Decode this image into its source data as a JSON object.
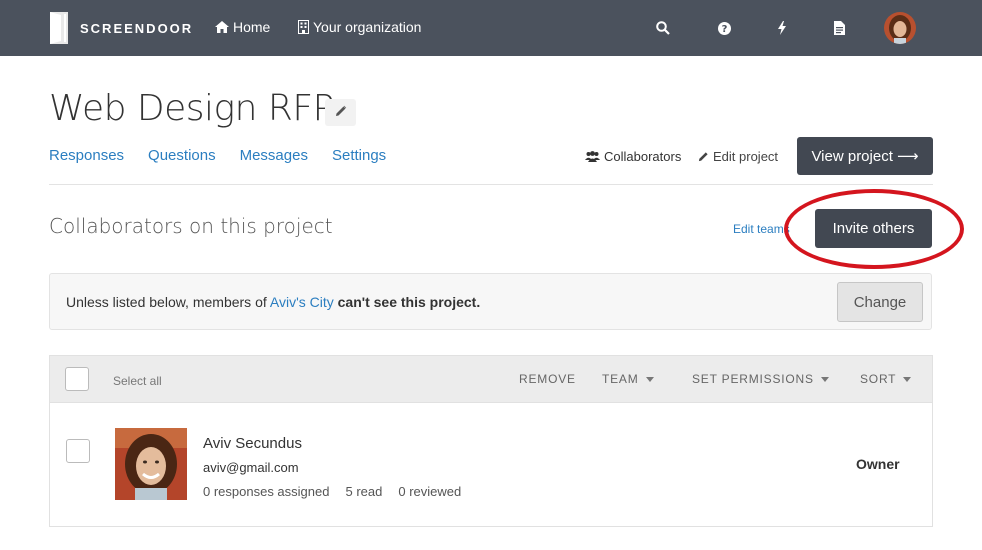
{
  "nav": {
    "brand": "SCREENDOOR",
    "home": "Home",
    "organization": "Your organization",
    "icons": [
      "search-icon",
      "help-icon",
      "bolt-icon",
      "document-icon"
    ]
  },
  "header": {
    "title": "Web Design RFP",
    "tabs": [
      "Responses",
      "Questions",
      "Messages",
      "Settings"
    ],
    "collaborators_link": "Collaborators",
    "edit_project_link": "Edit project",
    "view_project_button": "View project ⟶"
  },
  "section": {
    "title": "Collaborators on this project",
    "edit_teams": "Edit teams",
    "invite_button": "Invite others"
  },
  "notice": {
    "prefix": "Unless listed below, members of ",
    "org": "Aviv's City",
    "suffix": "can't see this project.",
    "change_button": "Change"
  },
  "table": {
    "select_all": "Select all",
    "remove": "REMOVE",
    "team": "TEAM",
    "set_permissions": "SET PERMISSIONS",
    "sort": "SORT"
  },
  "collaborator": {
    "name": "Aviv Secundus",
    "email": "aviv@gmail.com",
    "assigned": "0 responses assigned",
    "read": "5 read",
    "reviewed": "0 reviewed",
    "role": "Owner"
  },
  "colors": {
    "topbar": "#4b525d",
    "link": "#2b7ec0",
    "button_dark": "#424852",
    "highlight": "#d4151e"
  }
}
